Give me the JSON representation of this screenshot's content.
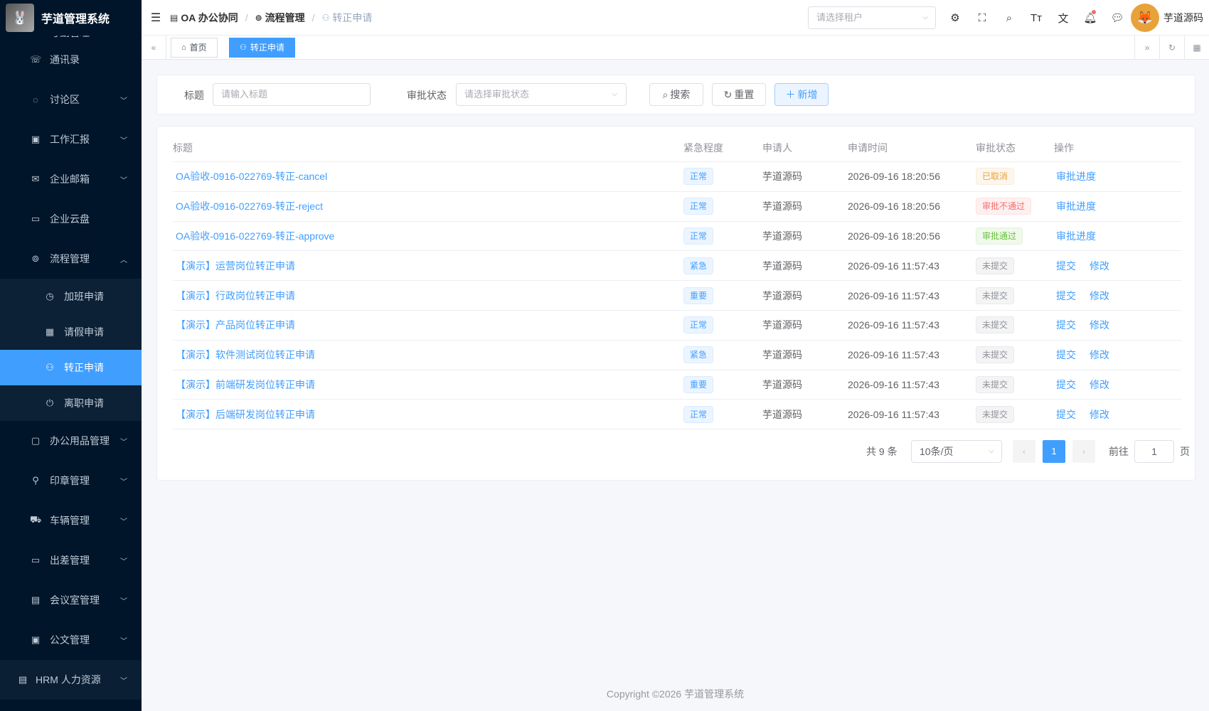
{
  "app": {
    "title": "芋道管理系统",
    "logo_icon": "rabbit-logo"
  },
  "sidebar": {
    "partial_item": "考勤管理",
    "items": [
      {
        "label": "通讯录",
        "icon": "phone-icon",
        "arrow": ""
      },
      {
        "label": "讨论区",
        "icon": "chat-icon",
        "arrow": "⌄"
      },
      {
        "label": "工作汇报",
        "icon": "report-icon",
        "arrow": "⌄"
      },
      {
        "label": "企业邮箱",
        "icon": "mail-icon",
        "arrow": "⌄"
      },
      {
        "label": "企业云盘",
        "icon": "folder-icon",
        "arrow": ""
      },
      {
        "label": "流程管理",
        "icon": "flow-icon",
        "arrow": "⌃"
      }
    ],
    "sub_items": [
      {
        "label": "加班申请",
        "icon": "timer-icon"
      },
      {
        "label": "请假申请",
        "icon": "calendar-icon"
      },
      {
        "label": "转正申请",
        "icon": "user-icon"
      },
      {
        "label": "离职申请",
        "icon": "power-icon"
      }
    ],
    "items2": [
      {
        "label": "办公用品管理",
        "icon": "box-icon",
        "arrow": "⌄"
      },
      {
        "label": "印章管理",
        "icon": "stamp-icon",
        "arrow": "⌄"
      },
      {
        "label": "车辆管理",
        "icon": "truck-icon",
        "arrow": "⌄"
      },
      {
        "label": "出差管理",
        "icon": "briefcase-icon",
        "arrow": "⌄"
      },
      {
        "label": "会议室管理",
        "icon": "building-icon",
        "arrow": "⌄"
      },
      {
        "label": "公文管理",
        "icon": "document-icon",
        "arrow": "⌄"
      }
    ],
    "hrm": {
      "label": "HRM 人力资源",
      "icon": "building-icon",
      "arrow": "⌄"
    }
  },
  "header": {
    "breadcrumb": [
      "OA 办公协同",
      "流程管理",
      "转正申请"
    ],
    "tenant_placeholder": "请选择租户",
    "user_name": "芋道源码"
  },
  "tags": {
    "home": "首页",
    "current": "转正申请"
  },
  "search": {
    "title_label": "标题",
    "title_placeholder": "请输入标题",
    "status_label": "审批状态",
    "status_placeholder": "请选择审批状态",
    "search_btn": "搜索",
    "reset_btn": "重置",
    "add_btn": "新增"
  },
  "table": {
    "columns": [
      "标题",
      "紧急程度",
      "申请人",
      "申请时间",
      "审批状态",
      "操作"
    ],
    "rows": [
      {
        "title": "OA验收-0916-022769-转正-cancel",
        "urgency": "正常",
        "urgency_color": "blue",
        "applicant": "芋道源码",
        "time": "2026-09-16 18:20:56",
        "status": "已取消",
        "status_color": "orange",
        "ops": [
          "审批进度"
        ]
      },
      {
        "title": "OA验收-0916-022769-转正-reject",
        "urgency": "正常",
        "urgency_color": "blue",
        "applicant": "芋道源码",
        "time": "2026-09-16 18:20:56",
        "status": "审批不通过",
        "status_color": "red",
        "ops": [
          "审批进度"
        ]
      },
      {
        "title": "OA验收-0916-022769-转正-approve",
        "urgency": "正常",
        "urgency_color": "blue",
        "applicant": "芋道源码",
        "time": "2026-09-16 18:20:56",
        "status": "审批通过",
        "status_color": "green",
        "ops": [
          "审批进度"
        ]
      },
      {
        "title": "【演示】运营岗位转正申请",
        "urgency": "紧急",
        "urgency_color": "blue",
        "applicant": "芋道源码",
        "time": "2026-09-16 11:57:43",
        "status": "未提交",
        "status_color": "gray",
        "ops": [
          "提交",
          "修改"
        ]
      },
      {
        "title": "【演示】行政岗位转正申请",
        "urgency": "重要",
        "urgency_color": "blue",
        "applicant": "芋道源码",
        "time": "2026-09-16 11:57:43",
        "status": "未提交",
        "status_color": "gray",
        "ops": [
          "提交",
          "修改"
        ]
      },
      {
        "title": "【演示】产品岗位转正申请",
        "urgency": "正常",
        "urgency_color": "blue",
        "applicant": "芋道源码",
        "time": "2026-09-16 11:57:43",
        "status": "未提交",
        "status_color": "gray",
        "ops": [
          "提交",
          "修改"
        ]
      },
      {
        "title": "【演示】软件测试岗位转正申请",
        "urgency": "紧急",
        "urgency_color": "blue",
        "applicant": "芋道源码",
        "time": "2026-09-16 11:57:43",
        "status": "未提交",
        "status_color": "gray",
        "ops": [
          "提交",
          "修改"
        ]
      },
      {
        "title": "【演示】前端研发岗位转正申请",
        "urgency": "重要",
        "urgency_color": "blue",
        "applicant": "芋道源码",
        "time": "2026-09-16 11:57:43",
        "status": "未提交",
        "status_color": "gray",
        "ops": [
          "提交",
          "修改"
        ]
      },
      {
        "title": "【演示】后端研发岗位转正申请",
        "urgency": "正常",
        "urgency_color": "blue",
        "applicant": "芋道源码",
        "time": "2026-09-16 11:57:43",
        "status": "未提交",
        "status_color": "gray",
        "ops": [
          "提交",
          "修改"
        ]
      }
    ]
  },
  "pagination": {
    "total_text": "共 9 条",
    "page_size": "10条/页",
    "current_page": "1",
    "jump_prefix": "前往",
    "jump_value": "1",
    "jump_suffix": "页"
  },
  "footer": {
    "copyright": "Copyright ©2026 芋道管理系统"
  },
  "colors": {
    "primary": "#409eff",
    "sidebar_bg": "#001529"
  }
}
